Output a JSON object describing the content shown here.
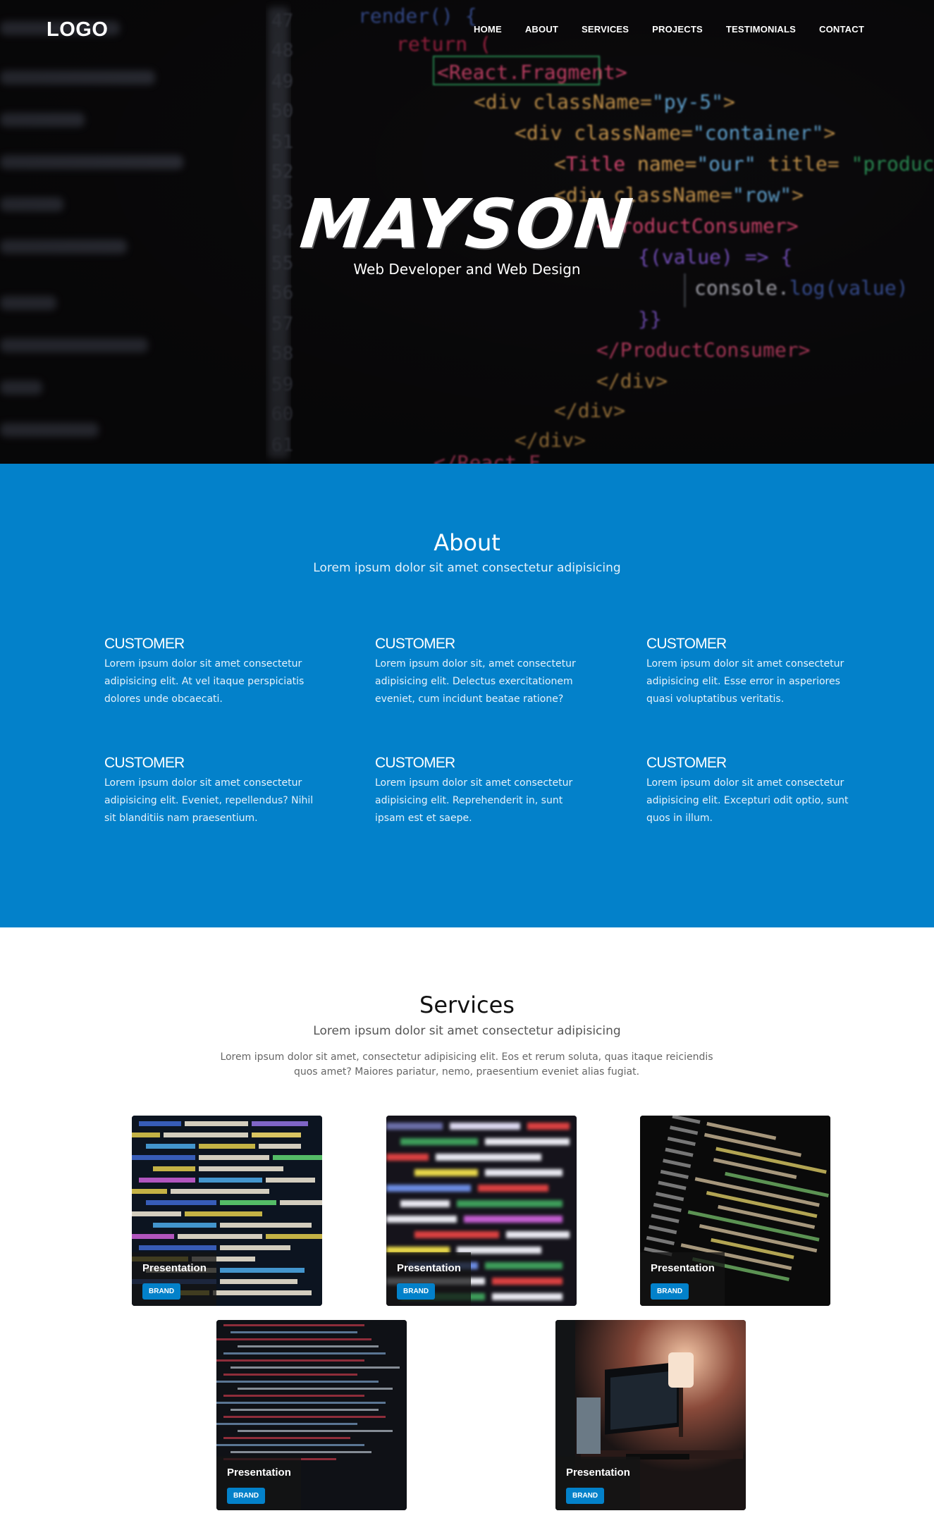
{
  "nav": {
    "logo": "LOGO",
    "links": [
      "HOME",
      "ABOUT",
      "SERVICES",
      "PROJECTS",
      "TESTIMONIALS",
      "CONTACT"
    ]
  },
  "hero": {
    "title": "MAYSON",
    "subtitle": "Web Developer and Web Design",
    "code_lines": [
      "render() {",
      "return (",
      "<React.Fragment>",
      "<div className=\"py-5\">",
      "<div className=\"container\">",
      "<Title name=\"our\" title= \"product",
      "<div className=\"row\">",
      "<ProductConsumer>",
      "{(value) => {",
      "console.log(value)",
      "}}",
      "</ProductConsumer>",
      "</div>",
      "</div>",
      "</div>"
    ]
  },
  "about": {
    "title": "About",
    "subtitle": "Lorem ipsum dolor sit amet consectetur adipisicing",
    "features": [
      {
        "title": "CUSTOMER",
        "text": "Lorem ipsum dolor sit amet consectetur adipisicing elit. At vel itaque perspiciatis dolores unde obcaecati."
      },
      {
        "title": "CUSTOMER",
        "text": "Lorem ipsum dolor sit, amet consectetur adipisicing elit. Delectus exercitationem eveniet, cum incidunt beatae ratione?"
      },
      {
        "title": "CUSTOMER",
        "text": "Lorem ipsum dolor sit amet consectetur adipisicing elit. Esse error in asperiores quasi voluptatibus veritatis."
      },
      {
        "title": "CUSTOMER",
        "text": "Lorem ipsum dolor sit amet consectetur adipisicing elit. Eveniet, repellendus? Nihil sit blanditiis nam praesentium."
      },
      {
        "title": "CUSTOMER",
        "text": "Lorem ipsum dolor sit amet consectetur adipisicing elit. Reprehenderit in, sunt ipsam est et saepe."
      },
      {
        "title": "CUSTOMER",
        "text": "Lorem ipsum dolor sit amet consectetur adipisicing elit. Excepturi odit optio, sunt quos in illum."
      }
    ]
  },
  "services": {
    "title": "Services",
    "subtitle": "Lorem ipsum dolor sit amet consectetur adipisicing",
    "description": "Lorem ipsum dolor sit amet, consectetur adipisicing elit. Eos et rerum soluta, quas itaque reiciendis quos amet? Maiores pariatur, nemo, praesentium eveniet alias fugiat.",
    "cards": [
      {
        "title": "Presentation",
        "badge": "BRAND"
      },
      {
        "title": "Presentation",
        "badge": "BRAND"
      },
      {
        "title": "Presentation",
        "badge": "BRAND"
      },
      {
        "title": "Presentation",
        "badge": "BRAND"
      },
      {
        "title": "Presentation",
        "badge": "BRAND"
      }
    ]
  },
  "colors": {
    "accent": "#0381ca",
    "hero_bg": "#0b0a0c"
  }
}
